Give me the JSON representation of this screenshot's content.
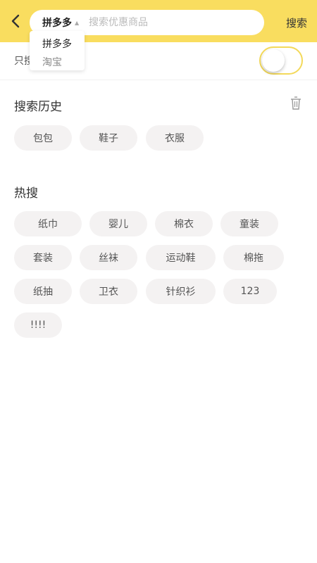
{
  "header": {
    "search_button": "搜索",
    "platform_selected": "拼多多",
    "search_placeholder": "搜索优惠商品"
  },
  "dropdown": {
    "options": [
      "拼多多",
      "淘宝"
    ]
  },
  "toggle_row": {
    "label_visible": "只搜",
    "enabled": false
  },
  "history": {
    "title": "搜索历史",
    "items": [
      "包包",
      "鞋子",
      "衣服"
    ]
  },
  "hot": {
    "title": "热搜",
    "items": [
      "纸巾",
      "婴儿",
      "棉衣",
      "童装",
      "套装",
      "丝袜",
      "运动鞋",
      "棉拖",
      "纸抽",
      "卫衣",
      "针织衫",
      "123",
      "!!!!"
    ]
  },
  "colors": {
    "header_bg": "#f9dd5f",
    "chip_bg": "#f4f2f2",
    "toggle_border": "#f3d95a"
  }
}
